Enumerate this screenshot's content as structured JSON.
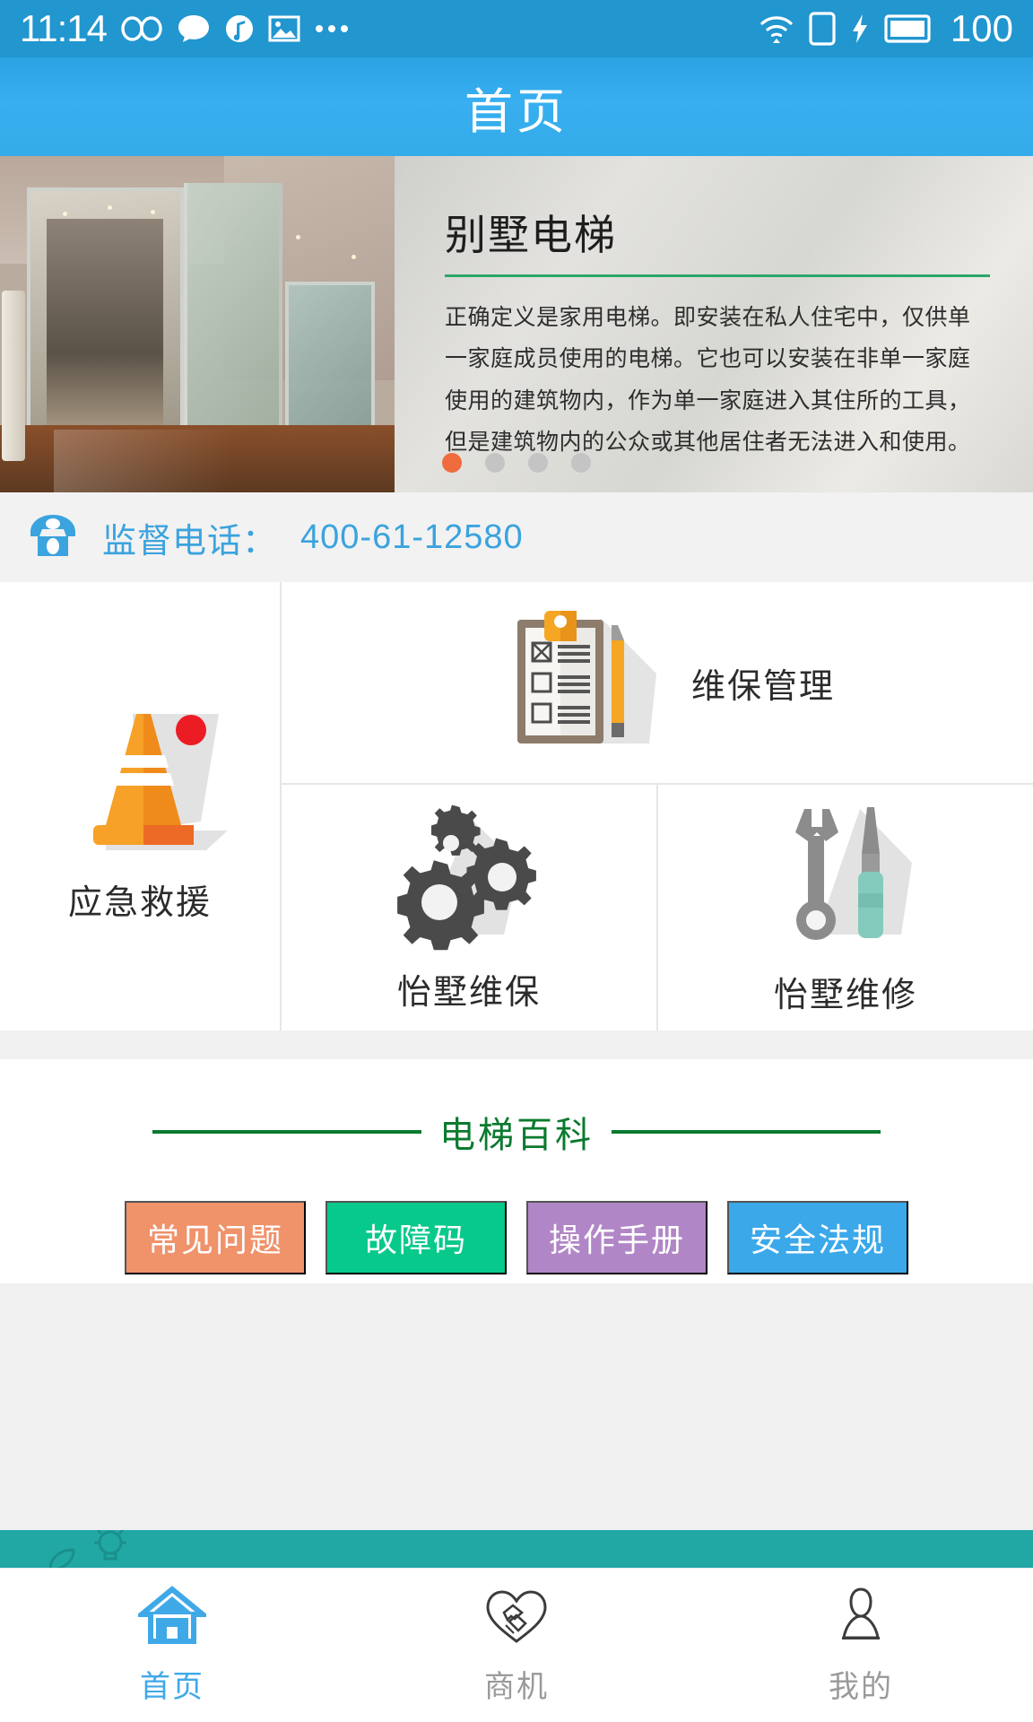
{
  "statusbar": {
    "time": "11:14",
    "battery": "100",
    "left_icons": [
      "infinity-icon",
      "chat-bubble-icon",
      "music-note-icon",
      "image-icon",
      "more-dots-icon"
    ],
    "right_icons": [
      "wifi-icon",
      "sim-card-icon",
      "charging-bolt-icon",
      "battery-icon"
    ]
  },
  "header": {
    "title": "首页",
    "bg": "#34ace9"
  },
  "carousel": {
    "title": "别墅电梯",
    "body": "正确定义是家用电梯。即安装在私人住宅中，仅供单一家庭成员使用的电梯。它也可以安装在非单一家庭使用的建筑物内，作为单一家庭进入其住所的工具，但是建筑物内的公众或其他居住者无法进入和使用。",
    "rule_color": "#2aa76a",
    "dots": 4,
    "active_dot": 0,
    "active_dot_color": "#ef6a3c",
    "inactive_dot_color": "#c4c4c4",
    "image_alt": "别墅电梯室内照片"
  },
  "hotline": {
    "icon": "telephone-icon",
    "label": "监督电话：",
    "number": "400-61-12580",
    "color": "#3ba3de"
  },
  "grid": {
    "emergency": {
      "label": "应急救援",
      "icon": "traffic-cone-icon",
      "badge": true,
      "badge_color": "#ec1c24"
    },
    "maintenance_mgmt": {
      "label": "维保管理",
      "icon": "clipboard-pencil-icon"
    },
    "villa_upkeep": {
      "label": "怡墅维保",
      "icon": "gears-icon"
    },
    "villa_repair": {
      "label": "怡墅维修",
      "icon": "wrench-screwdriver-icon"
    }
  },
  "encyclopedia": {
    "title": "电梯百科",
    "title_color": "#0a7a2e",
    "buttons": [
      {
        "label": "常见问题",
        "color": "#f0926a"
      },
      {
        "label": "故障码",
        "color": "#07c98b"
      },
      {
        "label": "操作手册",
        "color": "#b186c6"
      },
      {
        "label": "安全法规",
        "color": "#3ba8ea"
      }
    ]
  },
  "banner": {
    "color": "#21a8a5",
    "icon": "lightbulb-icon"
  },
  "bottomnav": {
    "items": [
      {
        "label": "首页",
        "icon": "home-icon",
        "active": true
      },
      {
        "label": "商机",
        "icon": "handshake-heart-icon",
        "active": false
      },
      {
        "label": "我的",
        "icon": "person-icon",
        "active": false
      }
    ],
    "active_color": "#3fa9e8",
    "inactive_color": "#9a9a9a"
  }
}
